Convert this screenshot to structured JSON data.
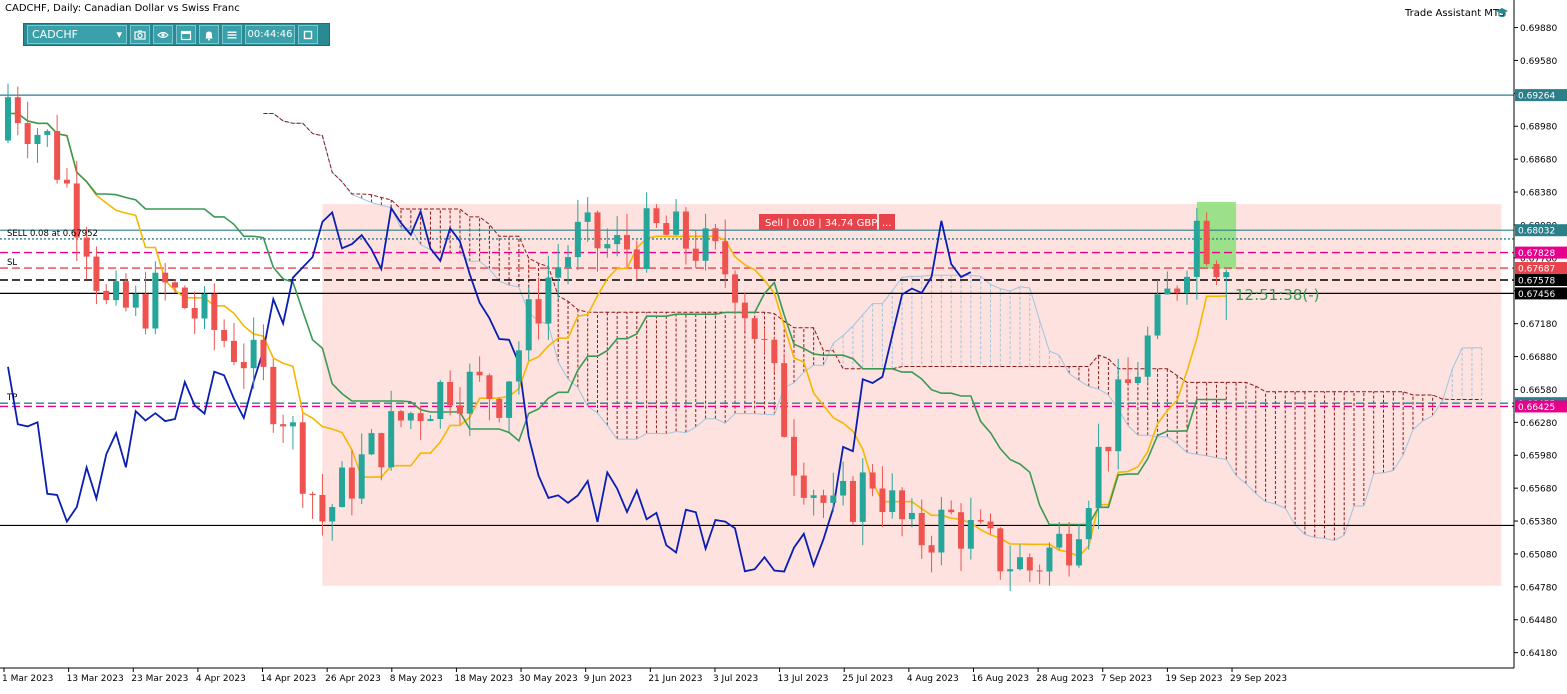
{
  "title": "CADCHF, Daily:  Canadian Dollar vs Swiss Franc",
  "trade_assistant_label": "Trade Assistant MT5",
  "toolbar": {
    "symbol": "CADCHF",
    "clock": "00:44:46",
    "icons": [
      "chevron-down-icon",
      "camera-icon",
      "eye-icon",
      "calendar-icon",
      "bell-icon",
      "menu-icon",
      "window-icon"
    ]
  },
  "colors": {
    "background": "#ffffff",
    "bull": "#26a69a",
    "bear": "#ef5350",
    "zone": "#fde2df",
    "tenkan": "#f5b800",
    "kijun": "#3a9a55",
    "chikou": "#0a1eb4",
    "kumo_bull": "#9fc6df",
    "kumo_bear": "#8b1a1a",
    "grid_line": "#2a7f8a",
    "sl": "#e8434a",
    "tp": "#e6008a",
    "toolbar": "#2a8a93"
  },
  "labels": {
    "sell_line": "SELL 0.08 at 0.67952",
    "sl": "SL",
    "tp": "TP",
    "order_panel": "Sell | 0.08 | 34.74 GBP",
    "order_more": "...",
    "countdown": "12:51:38(-)"
  },
  "chart_data": {
    "type": "candlestick",
    "symbol": "CADCHF",
    "timeframe": "Daily",
    "ylim": [
      0.6404,
      0.7004
    ],
    "y_ticks": [
      "0.69880",
      "0.69580",
      "0.69280",
      "0.68980",
      "0.68680",
      "0.68380",
      "0.68080",
      "0.67780",
      "0.67480",
      "0.67180",
      "0.66880",
      "0.66580",
      "0.66280",
      "0.65980",
      "0.65680",
      "0.65380",
      "0.65080",
      "0.64780",
      "0.64480",
      "0.64180"
    ],
    "x_ticks": [
      "1 Mar 2023",
      "13 Mar 2023",
      "23 Mar 2023",
      "4 Apr 2023",
      "14 Apr 2023",
      "26 Apr 2023",
      "8 May 2023",
      "18 May 2023",
      "30 May 2023",
      "9 Jun 2023",
      "21 Jun 2023",
      "3 Jul 2023",
      "13 Jul 2023",
      "25 Jul 2023",
      "4 Aug 2023",
      "16 Aug 2023",
      "28 Aug 2023",
      "7 Sep 2023",
      "19 Sep 2023",
      "29 Sep 2023"
    ],
    "price_tags": [
      {
        "value": 0.69264,
        "text": "0.69264",
        "bg": "#2a7f8a"
      },
      {
        "value": 0.68032,
        "text": "0.68032",
        "bg": "#2a7f8a"
      },
      {
        "value": 0.67828,
        "text": "0.67828",
        "bg": "#e6008a"
      },
      {
        "value": 0.67687,
        "text": "0.67687",
        "bg": "#e8434a"
      },
      {
        "value": 0.67578,
        "text": "0.67578",
        "bg": "#000000"
      },
      {
        "value": 0.67456,
        "text": "0.67456",
        "bg": "#000000"
      },
      {
        "value": 0.66455,
        "text": "0.66455",
        "bg": "#2a7f8a"
      },
      {
        "value": 0.66425,
        "text": "0.66425",
        "bg": "#e6008a"
      }
    ],
    "horizontal_lines": [
      {
        "value": 0.69264,
        "style": "solid",
        "color": "#2a7f8a"
      },
      {
        "value": 0.68032,
        "style": "solid",
        "color": "#2a7f8a"
      },
      {
        "value": 0.67952,
        "style": "dotted",
        "color": "#2a7f8a"
      },
      {
        "value": 0.67828,
        "style": "dash",
        "color": "#e6008a"
      },
      {
        "value": 0.67687,
        "style": "dash",
        "color": "#e8434a"
      },
      {
        "value": 0.67578,
        "style": "dash",
        "color": "#000000"
      },
      {
        "value": 0.67456,
        "style": "solid",
        "color": "#000000"
      },
      {
        "value": 0.66455,
        "style": "dash",
        "color": "#2a7f8a"
      },
      {
        "value": 0.66425,
        "style": "dash",
        "color": "#e6008a"
      },
      {
        "value": 0.6534,
        "style": "solid",
        "color": "#000000"
      }
    ],
    "zone": {
      "from_bar": 32,
      "to_bar": 152,
      "low": 0.6479,
      "high": 0.6827
    },
    "highlight": {
      "from_bar": 121,
      "to_bar": 125,
      "low": 0.6768,
      "high": 0.6829
    },
    "seed": {
      "start": 0.6885,
      "target": 0.6765
    },
    "anchors": [
      [
        0,
        0.6925
      ],
      [
        4,
        0.6885
      ],
      [
        8,
        0.68
      ],
      [
        10,
        0.673
      ],
      [
        13,
        0.673
      ],
      [
        16,
        0.675
      ],
      [
        20,
        0.672
      ],
      [
        24,
        0.669
      ],
      [
        28,
        0.664
      ],
      [
        32,
        0.654
      ],
      [
        36,
        0.659
      ],
      [
        40,
        0.663
      ],
      [
        45,
        0.6665
      ],
      [
        50,
        0.6655
      ],
      [
        55,
        0.676
      ],
      [
        58,
        0.6795
      ],
      [
        62,
        0.6785
      ],
      [
        66,
        0.68
      ],
      [
        70,
        0.679
      ],
      [
        74,
        0.676
      ],
      [
        77,
        0.669
      ],
      [
        80,
        0.66
      ],
      [
        84,
        0.654
      ],
      [
        88,
        0.658
      ],
      [
        92,
        0.652
      ],
      [
        96,
        0.654
      ],
      [
        100,
        0.651
      ],
      [
        104,
        0.6495
      ],
      [
        108,
        0.6525
      ],
      [
        112,
        0.662
      ],
      [
        116,
        0.67
      ],
      [
        119,
        0.676
      ],
      [
        121,
        0.681
      ],
      [
        123,
        0.678
      ],
      [
        124,
        0.6745
      ]
    ],
    "bar_count": 125
  }
}
